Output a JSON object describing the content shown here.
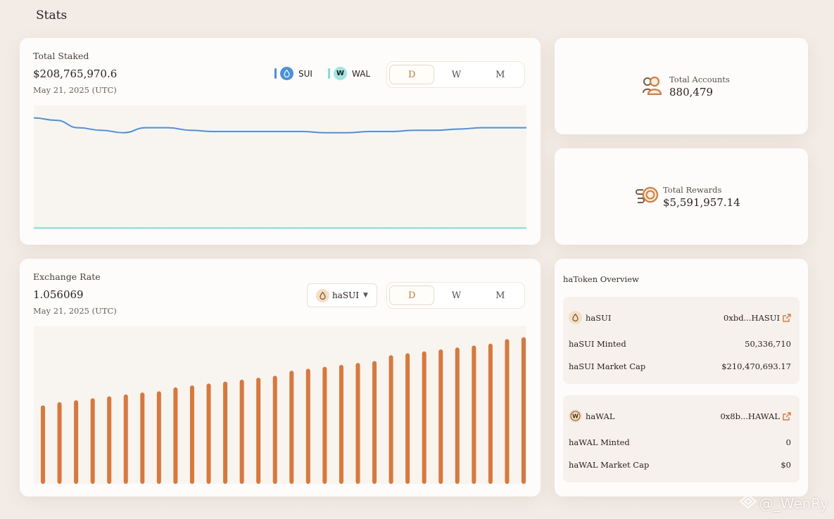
{
  "page": {
    "title": "Stats"
  },
  "total_staked": {
    "label": "Total Staked",
    "value": "$208,765,970.6",
    "date": "May 21, 2025 (UTC)",
    "legend": [
      {
        "name": "SUI",
        "color": "#4a90e2",
        "icon": "sui-drop-icon"
      },
      {
        "name": "WAL",
        "color": "#7fe0d8",
        "icon": "wal-w-icon"
      }
    ],
    "periods": [
      "D",
      "W",
      "M"
    ],
    "active_period": "D"
  },
  "exchange_rate": {
    "label": "Exchange Rate",
    "value": "1.056069",
    "date": "May 21, 2025 (UTC)",
    "token_select": "haSUI",
    "periods": [
      "D",
      "W",
      "M"
    ],
    "active_period": "D"
  },
  "accounts": {
    "label": "Total Accounts",
    "value": "880,479",
    "icon": "people-icon"
  },
  "rewards": {
    "label": "Total Rewards",
    "value": "$5,591,957.14",
    "icon": "coins-icon"
  },
  "overview": {
    "title": "haToken Overview",
    "tokens": [
      {
        "name": "haSUI",
        "address": "0xbd...HASUI",
        "rows": [
          {
            "label": "haSUI Minted",
            "value": "50,336,710"
          },
          {
            "label": "haSUI Market Cap",
            "value": "$210,470,693.17"
          }
        ]
      },
      {
        "name": "haWAL",
        "address": "0x8b...HAWAL",
        "rows": [
          {
            "label": "haWAL Minted",
            "value": "0"
          },
          {
            "label": "haWAL Market Cap",
            "value": "$0"
          }
        ]
      }
    ]
  },
  "watermark": "@_WenRy",
  "colors": {
    "accent": "#d9783a",
    "sui_line": "#4a90e2",
    "wal_line": "#7fe0d8",
    "background": "#f3ece6"
  },
  "chart_data": [
    {
      "type": "line",
      "series": [
        {
          "name": "SUI",
          "values": [
            0.9,
            0.88,
            0.82,
            0.8,
            0.78,
            0.82,
            0.82,
            0.8,
            0.79,
            0.79,
            0.79,
            0.79,
            0.79,
            0.78,
            0.78,
            0.79,
            0.79,
            0.8,
            0.8,
            0.81,
            0.82,
            0.82,
            0.82
          ]
        },
        {
          "name": "WAL",
          "values": [
            0.01,
            0.01,
            0.01,
            0.01,
            0.01,
            0.01,
            0.01,
            0.01,
            0.01,
            0.01,
            0.01,
            0.01,
            0.01,
            0.01,
            0.01,
            0.01,
            0.01,
            0.01,
            0.01,
            0.01,
            0.01,
            0.01,
            0.01
          ]
        }
      ],
      "ylim": [
        0,
        1
      ]
    },
    {
      "type": "bar",
      "values": [
        1.0452,
        1.0457,
        1.046,
        1.0463,
        1.0466,
        1.0469,
        1.0472,
        1.0474,
        1.048,
        1.0483,
        1.0486,
        1.0489,
        1.0492,
        1.0495,
        1.0498,
        1.0506,
        1.0509,
        1.0512,
        1.0515,
        1.0518,
        1.0521,
        1.053,
        1.0533,
        1.0536,
        1.0539,
        1.0542,
        1.0545,
        1.0548,
        1.0555,
        1.0558
      ],
      "ylim": [
        1.033,
        1.0575
      ]
    }
  ]
}
